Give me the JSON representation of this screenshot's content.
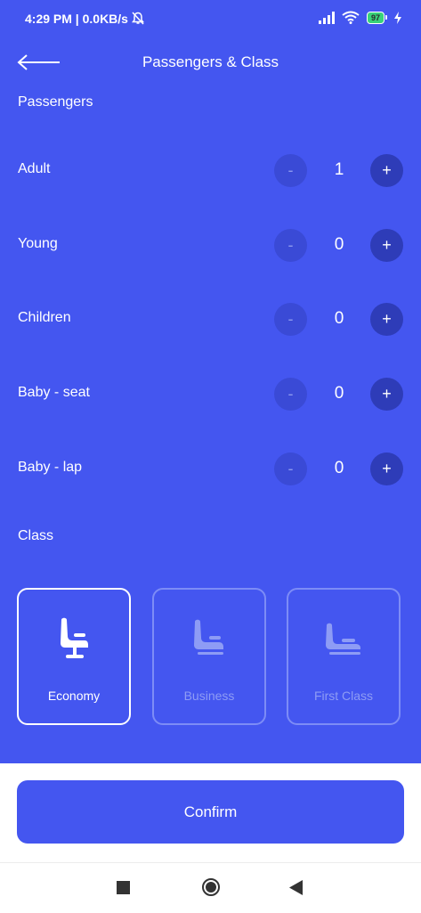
{
  "status_bar": {
    "time": "4:29 PM | 0.0KB/s",
    "battery": "97",
    "icons": [
      "mute-bell-icon",
      "signal-icon",
      "wifi-icon",
      "battery-icon",
      "charging-icon"
    ]
  },
  "header": {
    "title": "Passengers & Class",
    "back_icon": "arrow-left-icon"
  },
  "passengers": {
    "section_label": "Passengers",
    "rows": [
      {
        "label": "Adult",
        "count": "1",
        "minus": "-",
        "plus": "+"
      },
      {
        "label": "Young",
        "count": "0",
        "minus": "-",
        "plus": "+"
      },
      {
        "label": "Children",
        "count": "0",
        "minus": "-",
        "plus": "+"
      },
      {
        "label": "Baby - seat",
        "count": "0",
        "minus": "-",
        "plus": "+"
      },
      {
        "label": "Baby - lap",
        "count": "0",
        "minus": "-",
        "plus": "+"
      }
    ]
  },
  "class_section": {
    "section_label": "Class",
    "options": [
      {
        "label": "Economy",
        "icon": "economy-seat-icon",
        "selected": true
      },
      {
        "label": "Business",
        "icon": "business-seat-icon",
        "selected": false
      },
      {
        "label": "First Class",
        "icon": "first-class-seat-icon",
        "selected": false
      }
    ]
  },
  "confirm_label": "Confirm",
  "nav_bar": {
    "icons": [
      "recent-apps-icon",
      "home-icon",
      "back-icon"
    ]
  },
  "colors": {
    "primary": "#4456f0",
    "plus_button": "#2e3cb8",
    "minus_button": "#3a4ad6",
    "card_unselected_border": "#7d8cf6",
    "battery": "#38d27a"
  }
}
